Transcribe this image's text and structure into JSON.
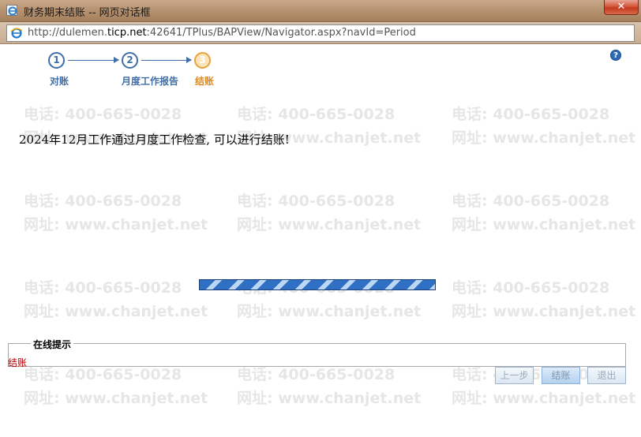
{
  "window": {
    "title": "财务期末结账 -- 网页对话框",
    "close_label": "✕"
  },
  "address": {
    "url_prefix": "http://dulemen.",
    "url_host": "ticp.net",
    "url_suffix": ":42641/TPlus/BAPView/Navigator.aspx?navId=Period"
  },
  "help_label": "?",
  "steps": [
    {
      "number": "1",
      "label": "对账"
    },
    {
      "number": "2",
      "label": "月度工作报告"
    },
    {
      "number": "3",
      "label": "结账"
    }
  ],
  "message": "2024年12月工作通过月度工作检查, 可以进行结账!",
  "progress": {
    "status": "indeterminate"
  },
  "online_hint": {
    "legend": "在线提示",
    "text": "结账"
  },
  "buttons": {
    "prev": "上一步",
    "close_account": "结账",
    "exit": "退出"
  },
  "watermark": {
    "phone": "电话: 400-665-0028",
    "site": "网址: www.chanjet.net"
  },
  "colors": {
    "step_active": "#e08a1a",
    "step_normal": "#3f6ea8",
    "hint_text": "#b00000"
  }
}
